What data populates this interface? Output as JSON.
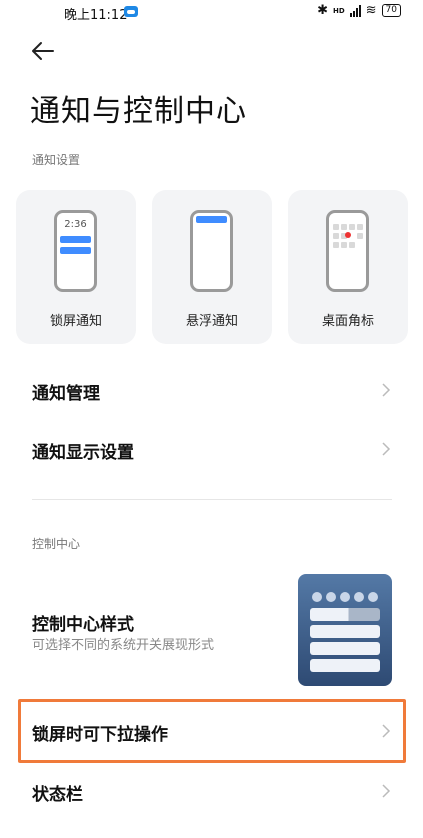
{
  "status_bar": {
    "time": "晚上11:12",
    "bluetooth_icon": "bluetooth-icon",
    "signal_text": "HD",
    "battery": "70"
  },
  "header": {
    "back_icon": "back-arrow-icon",
    "title": "通知与控制中心"
  },
  "notification_settings": {
    "section_label": "通知设置",
    "cards": [
      {
        "label": "锁屏通知",
        "preview_time": "2:36"
      },
      {
        "label": "悬浮通知"
      },
      {
        "label": "桌面角标"
      }
    ]
  },
  "list_items": [
    {
      "title": "通知管理"
    },
    {
      "title": "通知显示设置"
    }
  ],
  "control_center": {
    "section_label": "控制中心",
    "style_item": {
      "title": "控制中心样式",
      "subtitle": "可选择不同的系统开关展现形式"
    },
    "pulldown_item": {
      "title": "锁屏时可下拉操作"
    },
    "status_bar_item": {
      "title": "状态栏"
    }
  },
  "colors": {
    "accent_blue": "#3f8cff",
    "highlight": "#f07a3a",
    "badge_red": "#e33333"
  }
}
